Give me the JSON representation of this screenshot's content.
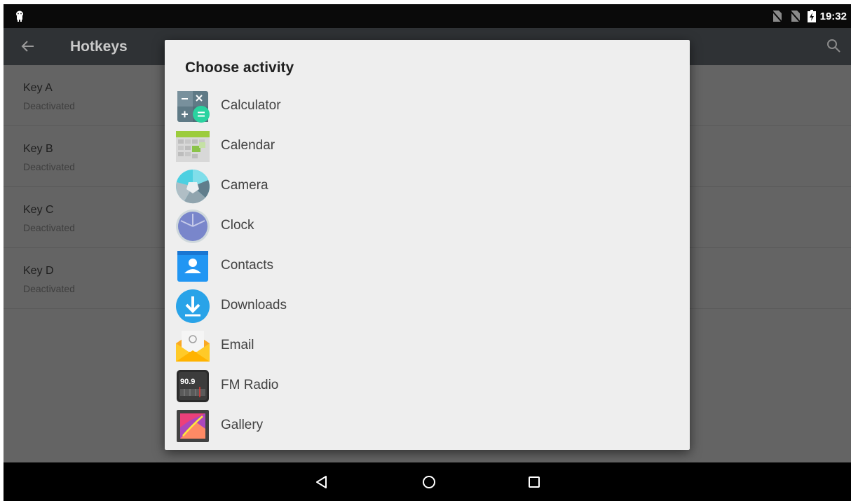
{
  "status_bar": {
    "time": "19:32",
    "icons": [
      "android-icon",
      "no-sim-icon",
      "no-sim-icon",
      "battery-charging-icon"
    ]
  },
  "app_bar": {
    "title": "Hotkeys",
    "back_icon": "arrow-back-icon",
    "search_icon": "search-icon"
  },
  "keys": [
    {
      "title": "Key A",
      "status": "Deactivated"
    },
    {
      "title": "Key B",
      "status": "Deactivated"
    },
    {
      "title": "Key C",
      "status": "Deactivated"
    },
    {
      "title": "Key D",
      "status": "Deactivated"
    }
  ],
  "dialog": {
    "title": "Choose activity",
    "items": [
      {
        "label": "Calculator",
        "icon": "calculator-icon"
      },
      {
        "label": "Calendar",
        "icon": "calendar-icon"
      },
      {
        "label": "Camera",
        "icon": "camera-icon"
      },
      {
        "label": "Clock",
        "icon": "clock-icon"
      },
      {
        "label": "Contacts",
        "icon": "contacts-icon"
      },
      {
        "label": "Downloads",
        "icon": "downloads-icon"
      },
      {
        "label": "Email",
        "icon": "email-icon"
      },
      {
        "label": "FM Radio",
        "icon": "fm-radio-icon"
      },
      {
        "label": "Gallery",
        "icon": "gallery-icon"
      }
    ],
    "fm_radio_display": "90.9"
  },
  "nav_bar": {
    "buttons": [
      "back-triangle-icon",
      "home-circle-icon",
      "recents-square-icon"
    ]
  },
  "colors": {
    "status_bar": "#0a0a0a",
    "app_bar_dimmed": "#2f3235",
    "content_dimmed": "#646464",
    "dialog_bg": "#eeeeee",
    "nav_bar": "#000000"
  }
}
